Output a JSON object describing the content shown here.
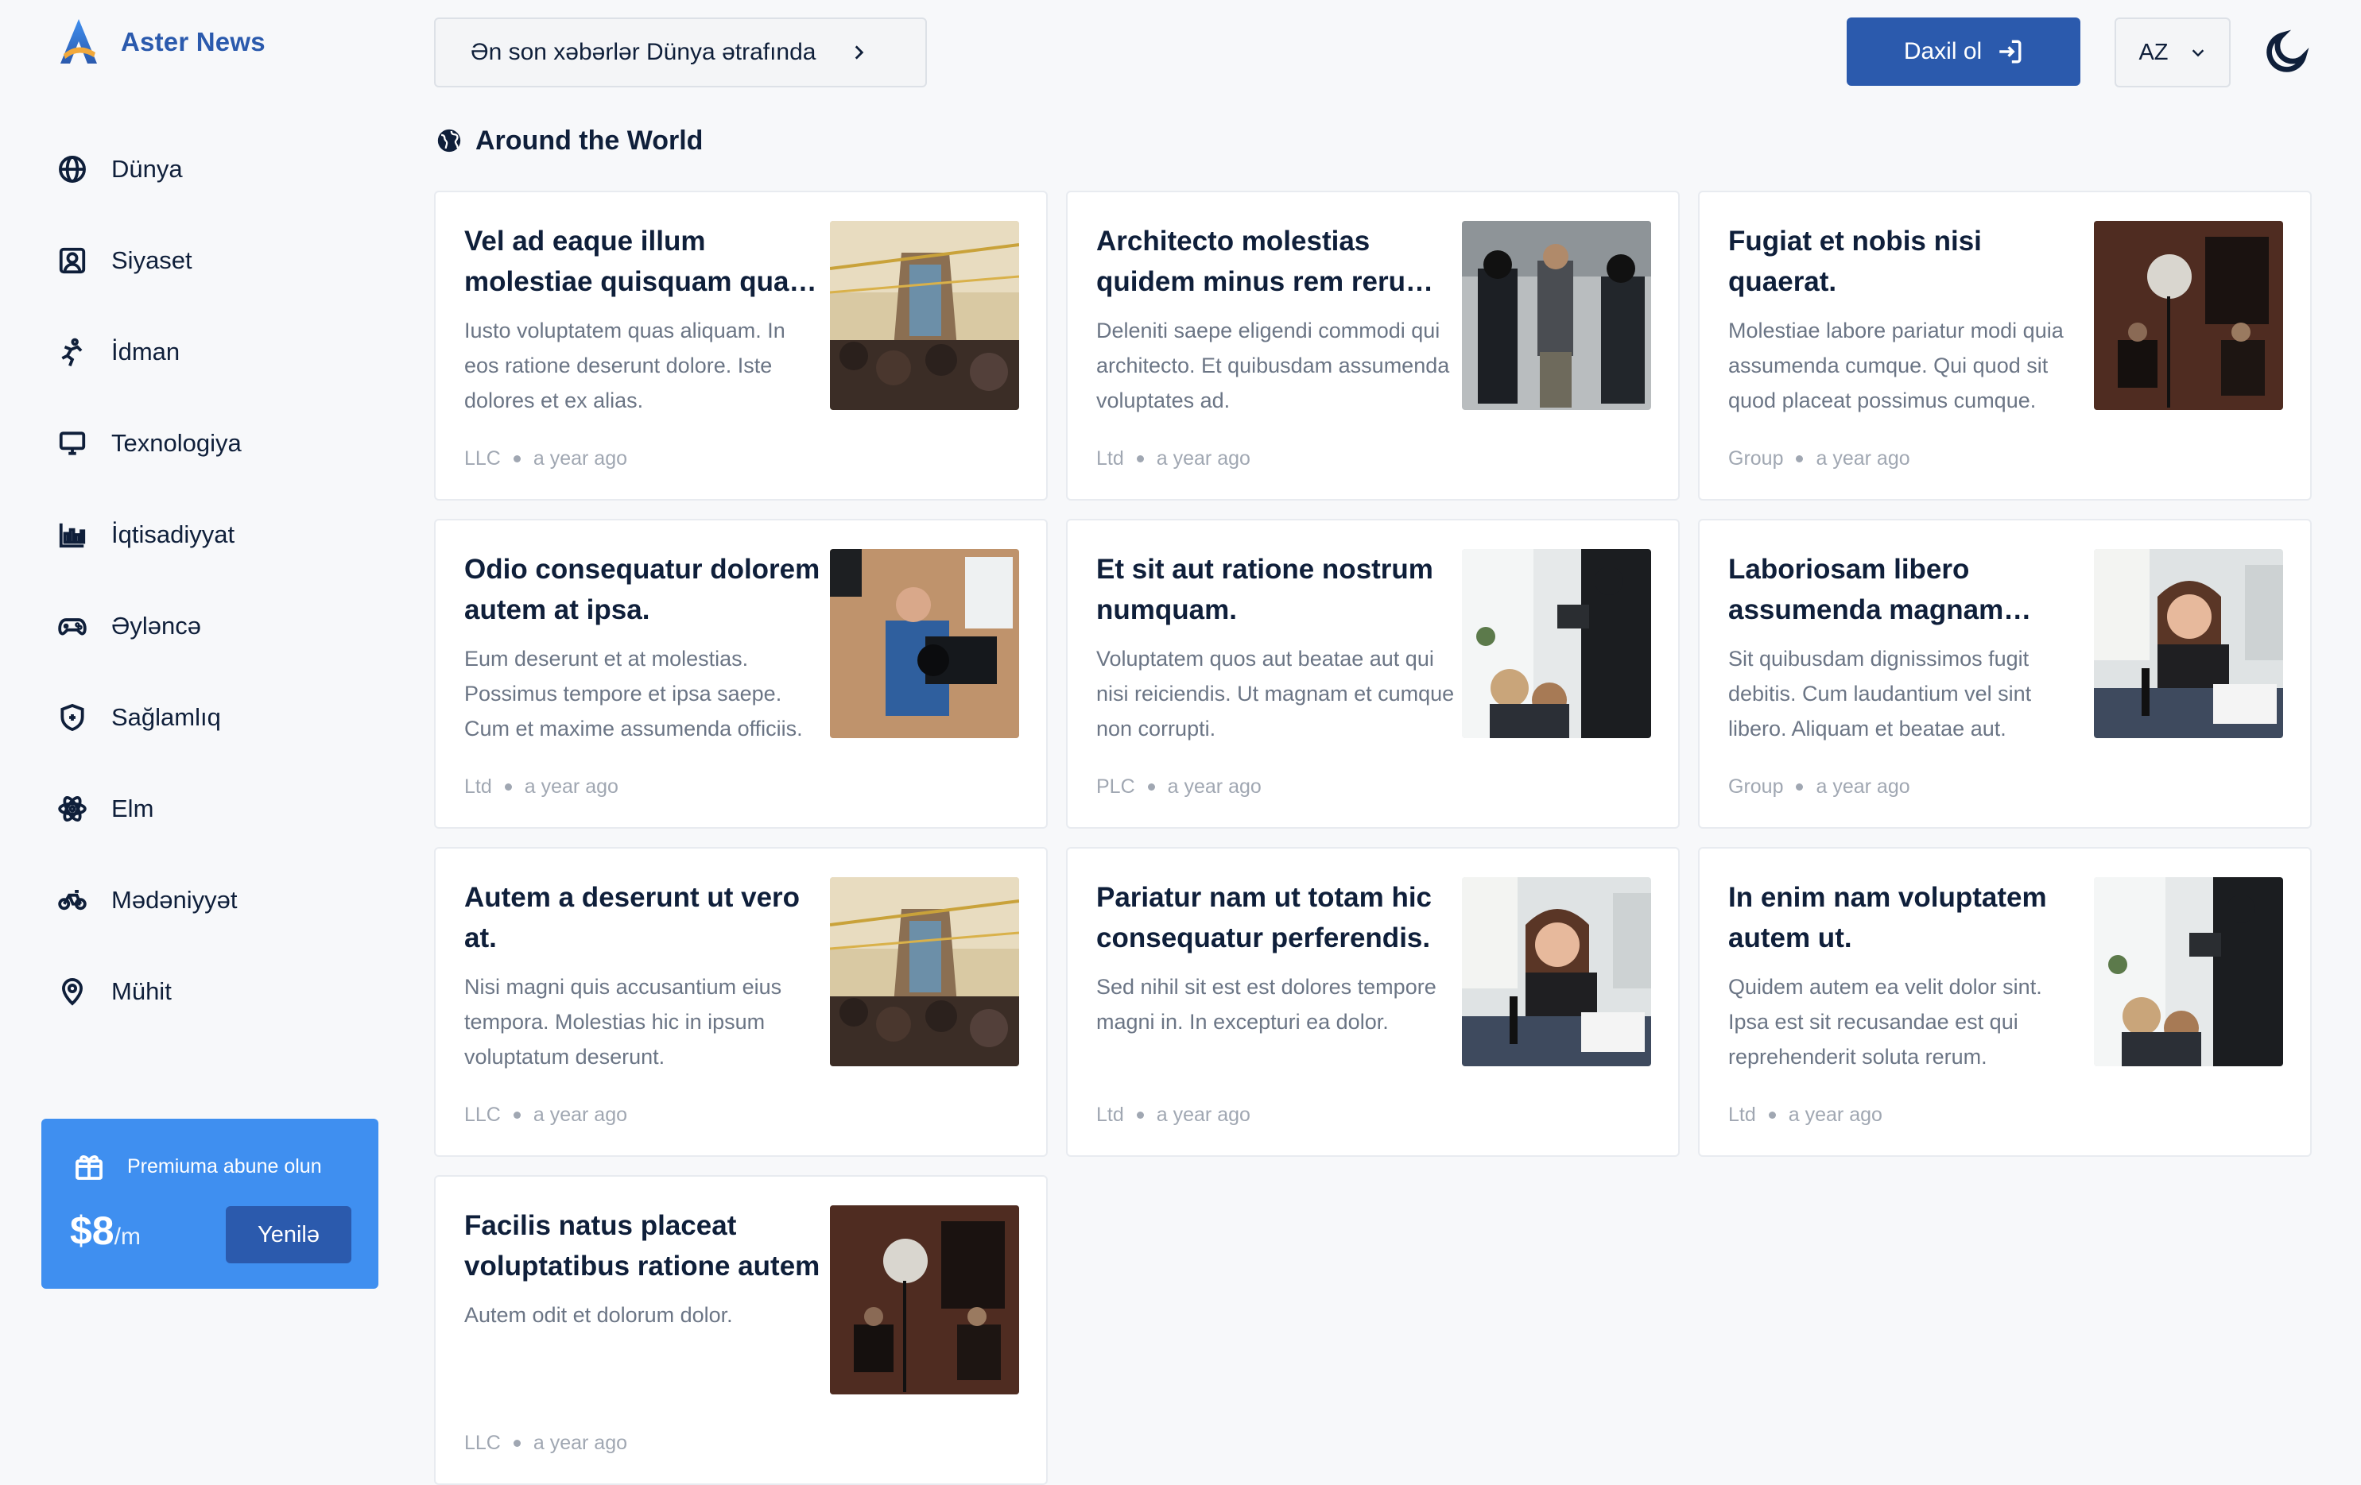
{
  "brand": {
    "name": "Aster News",
    "accent": "#2b5aad"
  },
  "nav": {
    "items": [
      {
        "label": "Dünya",
        "icon": "globe-icon"
      },
      {
        "label": "Siyaset",
        "icon": "portrait-icon"
      },
      {
        "label": "İdman",
        "icon": "sport-icon"
      },
      {
        "label": "Texnologiya",
        "icon": "monitor-icon"
      },
      {
        "label": "İqtisadiyyat",
        "icon": "bar-chart-icon"
      },
      {
        "label": "Əyləncə",
        "icon": "gamepad-icon"
      },
      {
        "label": "Sağlamlıq",
        "icon": "shield-icon"
      },
      {
        "label": "Elm",
        "icon": "atom-icon"
      },
      {
        "label": "Mədəniyyət",
        "icon": "bicycle-icon"
      },
      {
        "label": "Mühit",
        "icon": "location-pin-icon"
      }
    ]
  },
  "promo": {
    "title": "Premiuma abune olun",
    "price": "$8",
    "period": "/m",
    "button": "Yenilə",
    "color": "#3f8ff0"
  },
  "topbar": {
    "breaking": "Ən son xəbərlər Dünya ətrafında",
    "login": "Daxil ol",
    "language": "AZ"
  },
  "section": {
    "title": "Around the World"
  },
  "articles": [
    {
      "title": "Vel ad eaque illum molestiae quisquam quas aliquam",
      "excerpt": "Iusto voluptatem quas aliquam. In eos ratione deserunt dolore. Iste dolores et ex alias.",
      "source": "LLC",
      "time": "a year ago",
      "image": "street-festival"
    },
    {
      "title": "Architecto molestias quidem minus rem rerum ipsa",
      "excerpt": "Deleniti saepe eligendi commodi qui architecto. Et quibusdam assumenda voluptates ad.",
      "source": "Ltd",
      "time": "a year ago",
      "image": "street-protest"
    },
    {
      "title": "Fugiat et nobis nisi quaerat.",
      "excerpt": "Molestiae labore pariatur modi quia assumenda cumque. Qui quod sit quod placeat possimus cumque.",
      "source": "Group",
      "time": "a year ago",
      "image": "interview-studio"
    },
    {
      "title": "Odio consequatur dolorem autem at ipsa.",
      "excerpt": "Eum deserunt et at molestias. Possimus tempore et ipsa saepe. Cum et maxime assumenda officiis.",
      "source": "Ltd",
      "time": "a year ago",
      "image": "camera-operator"
    },
    {
      "title": "Et sit aut ratione nostrum numquam.",
      "excerpt": "Voluptatem quos aut beatae aut qui nisi reiciendis. Ut magnam et cumque non corrupti.",
      "source": "PLC",
      "time": "a year ago",
      "image": "filming-crowd"
    },
    {
      "title": "Laboriosam libero assumenda magnam dolores",
      "excerpt": "Sit quibusdam dignissimos fugit debitis. Cum laudantium vel sint libero. Aliquam et beatae aut.",
      "source": "Group",
      "time": "a year ago",
      "image": "podcast-host"
    },
    {
      "title": "Autem a deserunt ut vero at.",
      "excerpt": "Nisi magni quis accusantium eius tempora. Molestias hic in ipsum voluptatum deserunt.",
      "source": "LLC",
      "time": "a year ago",
      "image": "street-festival"
    },
    {
      "title": "Pariatur nam ut totam hic consequatur perferendis.",
      "excerpt": "Sed nihil sit est est dolores tempore magni in. In excepturi ea dolor.",
      "source": "Ltd",
      "time": "a year ago",
      "image": "podcast-host"
    },
    {
      "title": "In enim nam voluptatem autem ut.",
      "excerpt": "Quidem autem ea velit dolor sint. Ipsa est sit recusandae est qui reprehenderit soluta rerum.",
      "source": "Ltd",
      "time": "a year ago",
      "image": "filming-crowd"
    },
    {
      "title": "Facilis natus placeat voluptatibus ratione autem",
      "excerpt": "Autem odit et dolorum dolor.",
      "source": "LLC",
      "time": "a year ago",
      "image": "interview-studio"
    }
  ]
}
